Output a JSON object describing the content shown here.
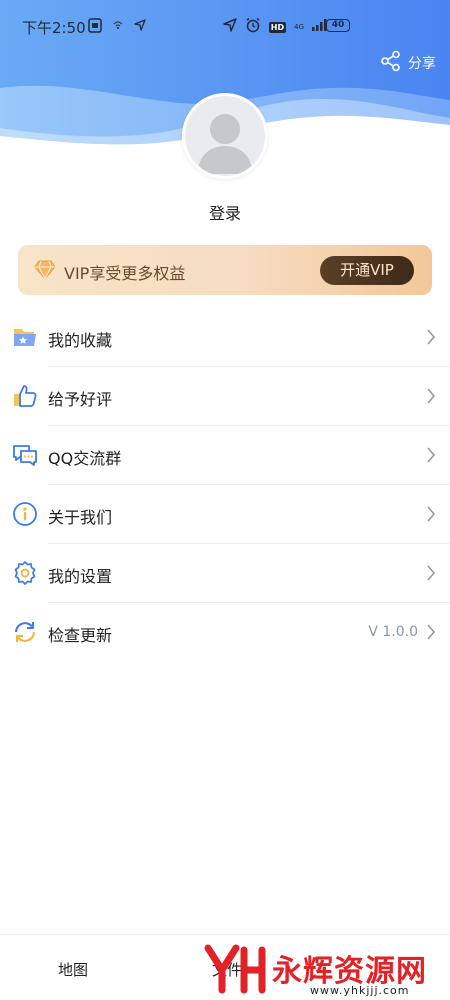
{
  "status_bar": {
    "time": "下午2:50",
    "network_label": "4G",
    "hd_label": "HD",
    "battery_level": "40"
  },
  "header": {
    "share_label": "分享",
    "gradient_colors": [
      "#64a9f6",
      "#4b86f3"
    ]
  },
  "profile": {
    "login_label": "登录"
  },
  "vip": {
    "promo_text": "VIP享受更多权益",
    "button_label": "开通VIP"
  },
  "menu": {
    "items": [
      {
        "label": "我的收藏",
        "icon": "favorite-folder-icon"
      },
      {
        "label": "给予好评",
        "icon": "thumbs-up-icon"
      },
      {
        "label": "QQ交流群",
        "icon": "chat-group-icon"
      },
      {
        "label": "关于我们",
        "icon": "info-icon"
      },
      {
        "label": "我的设置",
        "icon": "settings-gear-icon"
      },
      {
        "label": "检查更新",
        "icon": "refresh-icon",
        "value": "V 1.0.0"
      }
    ]
  },
  "tabbar": {
    "tabs": [
      {
        "label": "地图"
      },
      {
        "label": "文件"
      }
    ]
  },
  "watermark": {
    "brand": "永辉资源网",
    "url": "www.yhkjjj.com"
  }
}
